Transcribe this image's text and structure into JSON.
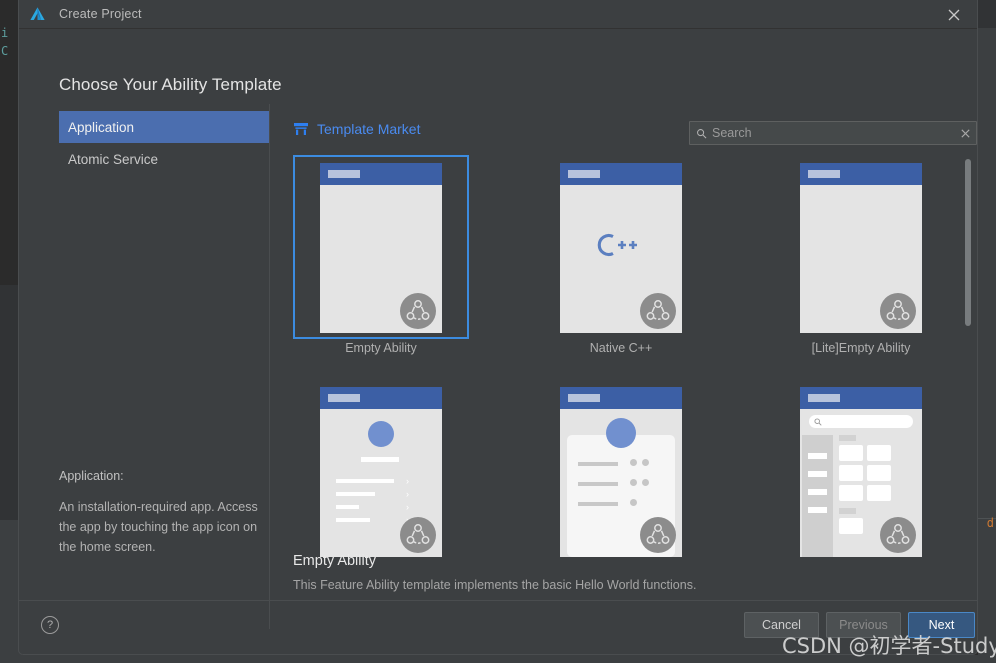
{
  "ide_background": {
    "code_lines": [
      "i",
      "C"
    ],
    "right_fragment": "d"
  },
  "window": {
    "title": "Create Project",
    "logo_icon": "deveco-logo-icon",
    "close_icon": "close-icon"
  },
  "heading": "Choose Your Ability Template",
  "sidebar": {
    "items": [
      {
        "label": "Application",
        "selected": true
      },
      {
        "label": "Atomic Service",
        "selected": false
      }
    ],
    "description_label": "Application:",
    "description_text": "An installation-required app. Access the app by touching the app icon on the home screen."
  },
  "market": {
    "link_label": "Template Market",
    "link_icon": "shop-icon",
    "link_color": "#4a8bf0"
  },
  "search": {
    "placeholder": "Search",
    "value": "",
    "search_icon": "search-icon",
    "clear_icon": "clear-x-icon"
  },
  "templates": [
    {
      "label": "Empty Ability",
      "kind": "empty",
      "selected": true
    },
    {
      "label": "Native C++",
      "kind": "nativecpp",
      "selected": false
    },
    {
      "label": "[Lite]Empty Ability",
      "kind": "empty",
      "selected": false
    },
    {
      "label": "",
      "kind": "list",
      "selected": false
    },
    {
      "label": "",
      "kind": "cardlist",
      "selected": false
    },
    {
      "label": "",
      "kind": "grid",
      "selected": false
    }
  ],
  "selection": {
    "title": "Empty Ability",
    "description": "This Feature Ability template implements the basic Hello World functions."
  },
  "footer": {
    "help_icon": "help-icon",
    "help_label": "?",
    "cancel_label": "Cancel",
    "previous_label": "Previous",
    "next_label": "Next",
    "next_accent": "#365880"
  },
  "watermark": "CSDN @初学者-Study"
}
